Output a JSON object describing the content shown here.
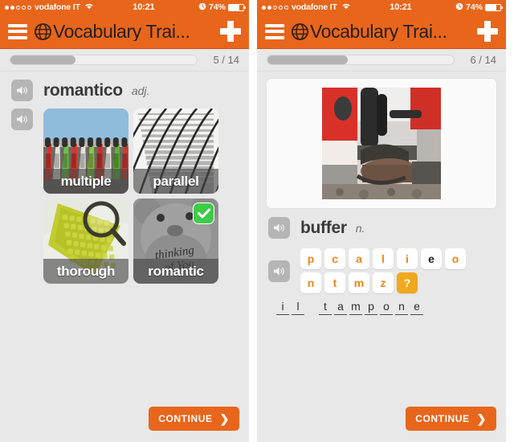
{
  "status_bar": {
    "carrier": "vodafone IT",
    "time": "10:21",
    "battery_percent": "74%",
    "signal_dots_filled": 2,
    "signal_dots_total": 5,
    "wifi_icon": "wifi-icon",
    "alarm_icon": "alarm-clock-icon",
    "battery_icon": "battery-icon",
    "battery_level": 70
  },
  "navbar": {
    "menu_icon": "hamburger-menu-icon",
    "logo_icon": "app-logo-globe-icon",
    "title": "Vocabulary Trai...",
    "add_icon": "plus-icon"
  },
  "colors": {
    "accent_orange": "#e8661b",
    "letter_orange": "#e8861b",
    "highlight_orange": "#f2a81d",
    "success_green": "#3fcb4a",
    "page_gray": "#e8e8e8",
    "progress_fill": "#b3b3b3"
  },
  "left_screen": {
    "progress": {
      "counter": "5 / 14",
      "percent": 35
    },
    "prompt": {
      "speaker_icon": "speaker-icon",
      "word": "romantico",
      "part_of_speech": "adj."
    },
    "grid_speaker_icon": "speaker-icon",
    "options": [
      {
        "label": "multiple",
        "art": "scooters",
        "selected": false
      },
      {
        "label": "parallel",
        "art": "rails",
        "selected": false
      },
      {
        "label": "thorough",
        "art": "keyboard",
        "selected": false
      },
      {
        "label": "romantic",
        "art": "teddy",
        "selected": true,
        "badge_icon": "checkmark-icon"
      }
    ],
    "continue": {
      "label": "CONTINUE",
      "chevron": "chevron-right-icon"
    }
  },
  "right_screen": {
    "progress": {
      "counter": "6 / 14",
      "percent": 43
    },
    "picture": {
      "alt_name": "train-buffer-photo"
    },
    "prompt": {
      "speaker_icon": "speaker-icon",
      "word": "buffer",
      "part_of_speech": "n."
    },
    "letters_speaker_icon": "speaker-icon",
    "letter_rows": [
      [
        {
          "ch": "p",
          "style": "normal"
        },
        {
          "ch": "c",
          "style": "normal"
        },
        {
          "ch": "a",
          "style": "normal"
        },
        {
          "ch": "l",
          "style": "normal"
        },
        {
          "ch": "i",
          "style": "normal"
        },
        {
          "ch": "e",
          "style": "dark"
        },
        {
          "ch": "o",
          "style": "normal"
        }
      ],
      [
        {
          "ch": "n",
          "style": "normal"
        },
        {
          "ch": "t",
          "style": "normal"
        },
        {
          "ch": "m",
          "style": "normal"
        },
        {
          "ch": "z",
          "style": "normal"
        },
        {
          "ch": "?",
          "style": "highlight"
        }
      ]
    ],
    "answer_words": [
      {
        "chars": [
          "i",
          "l"
        ]
      },
      {
        "chars": [
          "t",
          "a",
          "m",
          "p",
          "o",
          "n",
          "e"
        ]
      }
    ],
    "continue": {
      "label": "CONTINUE",
      "chevron": "chevron-right-icon"
    }
  }
}
